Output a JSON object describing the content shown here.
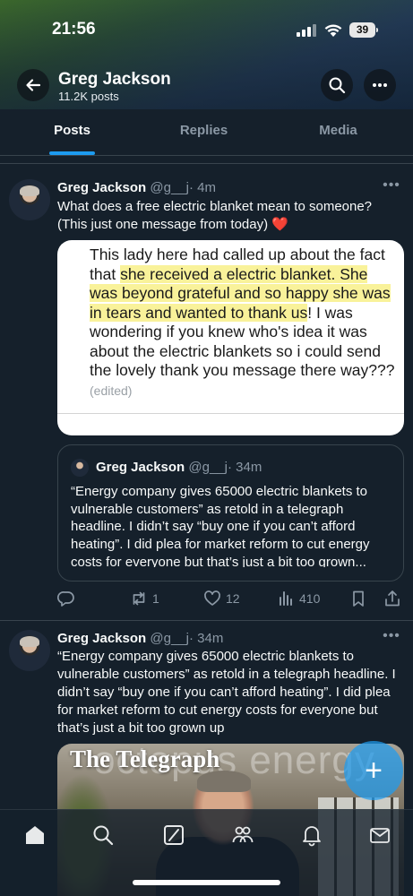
{
  "status": {
    "time": "21:56",
    "battery": "39"
  },
  "profile": {
    "name": "Greg Jackson",
    "posts": "11.2K posts"
  },
  "tabs": [
    {
      "label": "Posts",
      "active": true
    },
    {
      "label": "Replies",
      "active": false
    },
    {
      "label": "Media",
      "active": false
    }
  ],
  "posts": [
    {
      "name": "Greg Jackson",
      "handle": "@g__j",
      "time": "· 4m",
      "text": "What does a free electric blanket mean to someone? (This just one message from today) ❤️",
      "media_message": {
        "line_1": "This lady here had called up about the fact that ",
        "highlight_1": "she received a electric blanket. She was beyond grateful and so happy she was in tears and wanted to thank us",
        "line_2": "! I was wondering if you knew who's idea it was about the electric blankets so i could send the lovely thank you message there way???",
        "edited": "(edited)"
      },
      "quote": {
        "name": "Greg Jackson",
        "handle": "@g__j",
        "time": "· 34m",
        "text": "“Energy company gives 65000 electric blankets to vulnerable customers” as retold in a telegraph headline. I didn’t say “buy one if you can’t afford heating”. I did plea for market reform to cut energy costs for everyone but that’s just a bit too grown..."
      },
      "actions": {
        "replies": "",
        "reposts": "1",
        "likes": "12",
        "views": "410"
      }
    },
    {
      "name": "Greg Jackson",
      "handle": "@g__j",
      "time": "· 34m",
      "text": "“Energy company gives 65000 electric blankets to vulnerable customers” as retold in a telegraph headline. I didn’t say “buy one if you can’t afford heating”. I did plea for market reform to cut energy costs for everyone but that’s just a bit too grown up",
      "image": {
        "masthead": "The Telegraph",
        "background_word": "octopus energy"
      }
    }
  ],
  "fab": {
    "label": "+"
  },
  "colors": {
    "background": "#15202b",
    "accent": "#1d9bf0",
    "muted": "#8b98a5",
    "heart": "#f91880"
  },
  "icons": [
    "back-arrow-icon",
    "search-icon",
    "more-icon",
    "reply-icon",
    "repost-icon",
    "like-icon",
    "views-icon",
    "bookmark-icon",
    "share-icon",
    "home-icon",
    "explore-icon",
    "grok-icon",
    "communities-icon",
    "notifications-icon",
    "messages-icon"
  ]
}
